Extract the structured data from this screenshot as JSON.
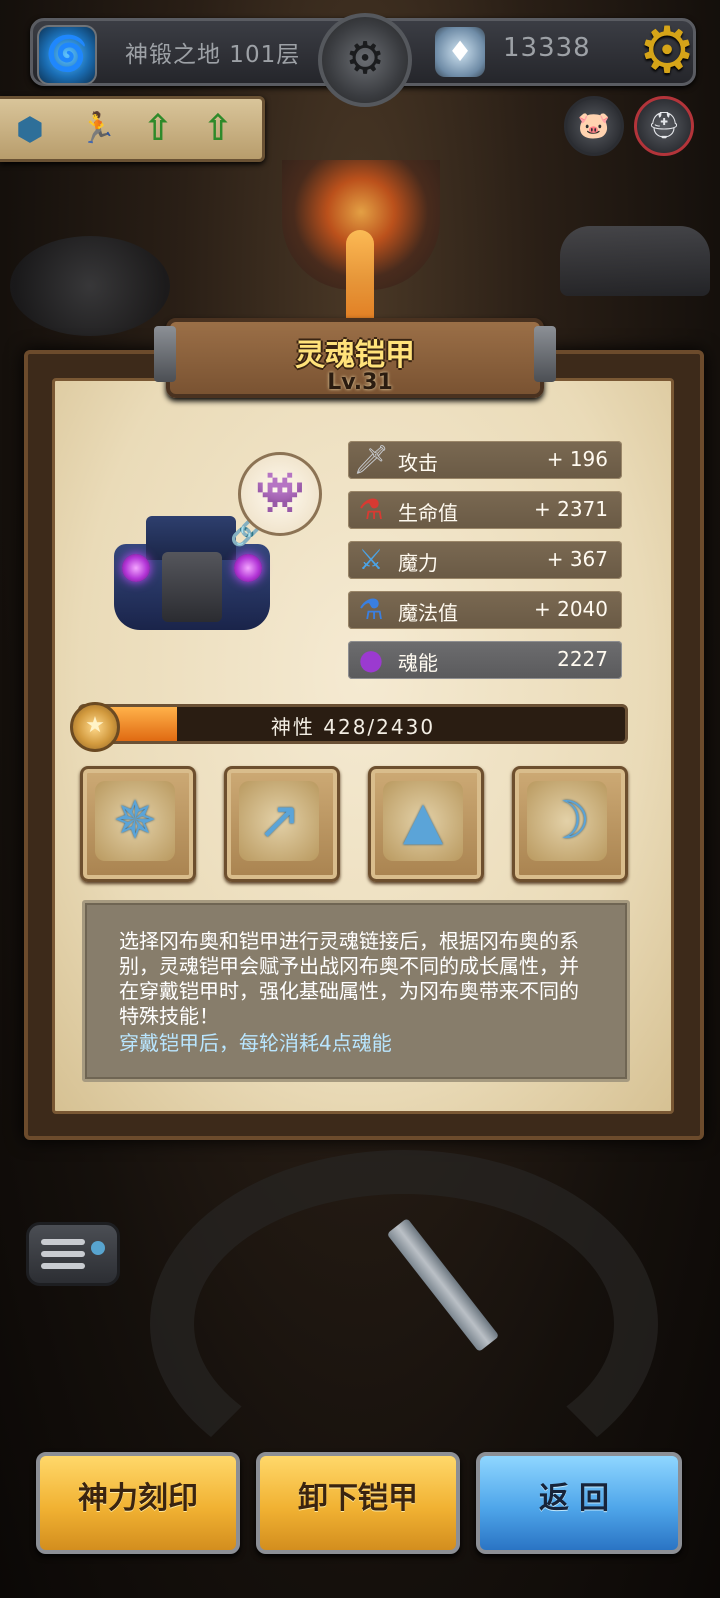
{
  "top_bar": {
    "floor_icon": "vortex-icon",
    "floor_name": "神锻之地 101层",
    "center_icon": "gear-emblem-icon",
    "currency_icon": "gem-icon",
    "currency_amount": "13338",
    "settings_icon": "settings-gear-icon"
  },
  "buffs": [
    "shield-buff-icon",
    "runner-buff-icon",
    "arrow-up-icon",
    "arrow-up-icon"
  ],
  "side_buttons": [
    "pig-icon",
    "helmet-icon"
  ],
  "armor": {
    "name": "灵魂铠甲",
    "level": "Lv.31",
    "linked_hero_icon": "hero-avatar-icon",
    "chain_icon": "chain-link-icon"
  },
  "stats": [
    {
      "icon": "sword-icon",
      "label": "攻击",
      "value": "+ 196",
      "color": "#c9ccd1"
    },
    {
      "icon": "red-potion-icon",
      "label": "生命值",
      "value": "+ 2371",
      "color": "#d83a32"
    },
    {
      "icon": "magic-sword-icon",
      "label": "魔力",
      "value": "+ 367",
      "color": "#4aa4e8"
    },
    {
      "icon": "blue-potion-icon",
      "label": "魔法值",
      "value": "+ 2040",
      "color": "#3a7fe0"
    },
    {
      "icon": "soul-orb-icon",
      "label": "魂能",
      "value": "2227",
      "color": "#9b3ad0"
    }
  ],
  "divinity": {
    "label": "神性 428/2430",
    "current": 428,
    "max": 2430,
    "icon": "divinity-medal-icon"
  },
  "skills": [
    "whirlwind-skill-icon",
    "slash-skill-icon",
    "vortex-skill-icon",
    "crescent-skill-icon"
  ],
  "description": {
    "text": "选择冈布奥和铠甲进行灵魂链接后，根据冈布奥的系别，灵魂铠甲会赋予出战冈布奥不同的成长属性，并在穿戴铠甲时，强化基础属性，为冈布奥带来不同的特殊技能！",
    "note": "穿戴铠甲后，每轮消耗4点魂能"
  },
  "bottom_buttons": {
    "engrave": "神力刻印",
    "unequip": "卸下铠甲",
    "back": "返回"
  }
}
